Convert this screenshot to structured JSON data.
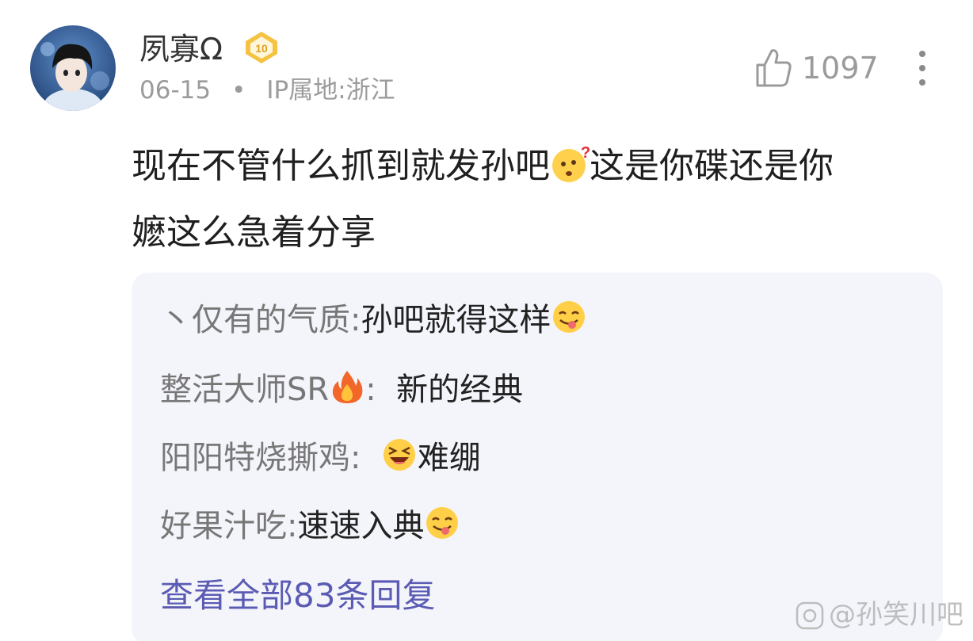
{
  "comment": {
    "author": {
      "name": "夙寡Ω",
      "level": "10"
    },
    "date": "06-15",
    "separator": "•",
    "ip_location": "IP属地:浙江",
    "like_count": "1097",
    "text_part1": "现在不管什么抓到就发孙吧",
    "text_part2": "这是你碟还是你",
    "text_line2": "嬷这么急着分享"
  },
  "replies": [
    {
      "name": "丶仅有的气质:",
      "text_before": "孙吧就得这样",
      "text_after": ""
    },
    {
      "name": "整活大师SR",
      "name_suffix": ":",
      "text_before": "新的经典",
      "text_after": ""
    },
    {
      "name": "阳阳特烧撕鸡:",
      "text_before": "",
      "text_after": "难绷"
    },
    {
      "name": "好果汁吃:",
      "text_before": "速速入典",
      "text_after": ""
    }
  ],
  "view_all_replies": "查看全部83条回复",
  "watermark": "@孙笑川吧",
  "icons": {
    "avatar": "avatar-image",
    "level_badge": "level-badge-icon",
    "like": "thumbs-up-icon",
    "more": "more-vertical-icon",
    "emoji_thinking": "confused-face-emoji",
    "emoji_tongue": "yum-face-emoji",
    "emoji_fire": "fire-emoji",
    "emoji_laugh": "squinting-laugh-emoji"
  },
  "colors": {
    "username": "#333333",
    "meta": "#9b9b9b",
    "reply_name": "#777777",
    "link": "#5b5bb4",
    "reply_bg": "#f4f5fb",
    "badge": "#f5c242"
  }
}
